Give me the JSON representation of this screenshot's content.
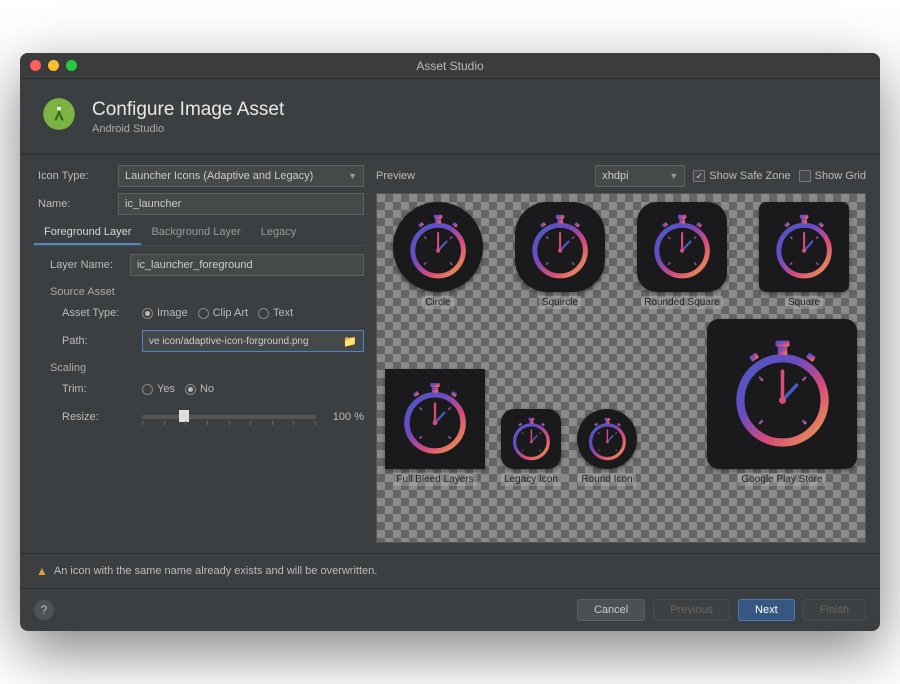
{
  "window": {
    "title": "Asset Studio"
  },
  "header": {
    "title": "Configure Image Asset",
    "subtitle": "Android Studio"
  },
  "form": {
    "iconTypeLabel": "Icon Type:",
    "iconTypeValue": "Launcher Icons (Adaptive and Legacy)",
    "nameLabel": "Name:",
    "nameValue": "ic_launcher",
    "tabs": {
      "fg": "Foreground Layer",
      "bg": "Background Layer",
      "legacy": "Legacy"
    },
    "layerNameLabel": "Layer Name:",
    "layerNameValue": "ic_launcher_foreground",
    "sourceAsset": "Source Asset",
    "assetTypeLabel": "Asset Type:",
    "assetTypes": {
      "image": "Image",
      "clipart": "Clip Art",
      "text": "Text"
    },
    "pathLabel": "Path:",
    "pathValue": "ve icon/adaptive-icon-forground.png",
    "scaling": "Scaling",
    "trimLabel": "Trim:",
    "trimOptions": {
      "yes": "Yes",
      "no": "No"
    },
    "resizeLabel": "Resize:",
    "resizeValue": "100 %"
  },
  "preview": {
    "label": "Preview",
    "density": "xhdpi",
    "showSafeZone": "Show Safe Zone",
    "showGrid": "Show Grid",
    "shapes": {
      "circle": "Circle",
      "squircle": "Squircle",
      "rounded": "Rounded Square",
      "square": "Square",
      "fullBleed": "Full Bleed Layers",
      "legacy": "Legacy Icon",
      "round": "Round Icon",
      "playStore": "Google Play Store"
    }
  },
  "warning": "An icon with the same name already exists and will be overwritten.",
  "footer": {
    "cancel": "Cancel",
    "previous": "Previous",
    "next": "Next",
    "finish": "Finish"
  }
}
